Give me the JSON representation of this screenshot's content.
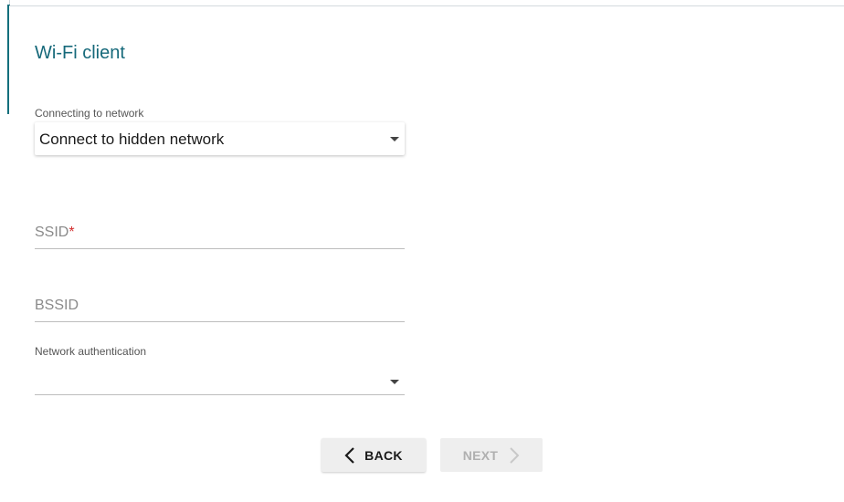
{
  "page": {
    "title": "Wi-Fi client"
  },
  "connecting": {
    "label": "Connecting to network",
    "value": "Connect to hidden network"
  },
  "ssid": {
    "placeholder": "SSID",
    "required_mark": "*",
    "value": ""
  },
  "bssid": {
    "placeholder": "BSSID",
    "value": ""
  },
  "auth": {
    "label": "Network authentication",
    "value": ""
  },
  "buttons": {
    "back": "BACK",
    "next": "NEXT"
  },
  "colors": {
    "accent": "#16697a",
    "required": "#d32f2f",
    "disabled_text": "#b0b0b0"
  }
}
